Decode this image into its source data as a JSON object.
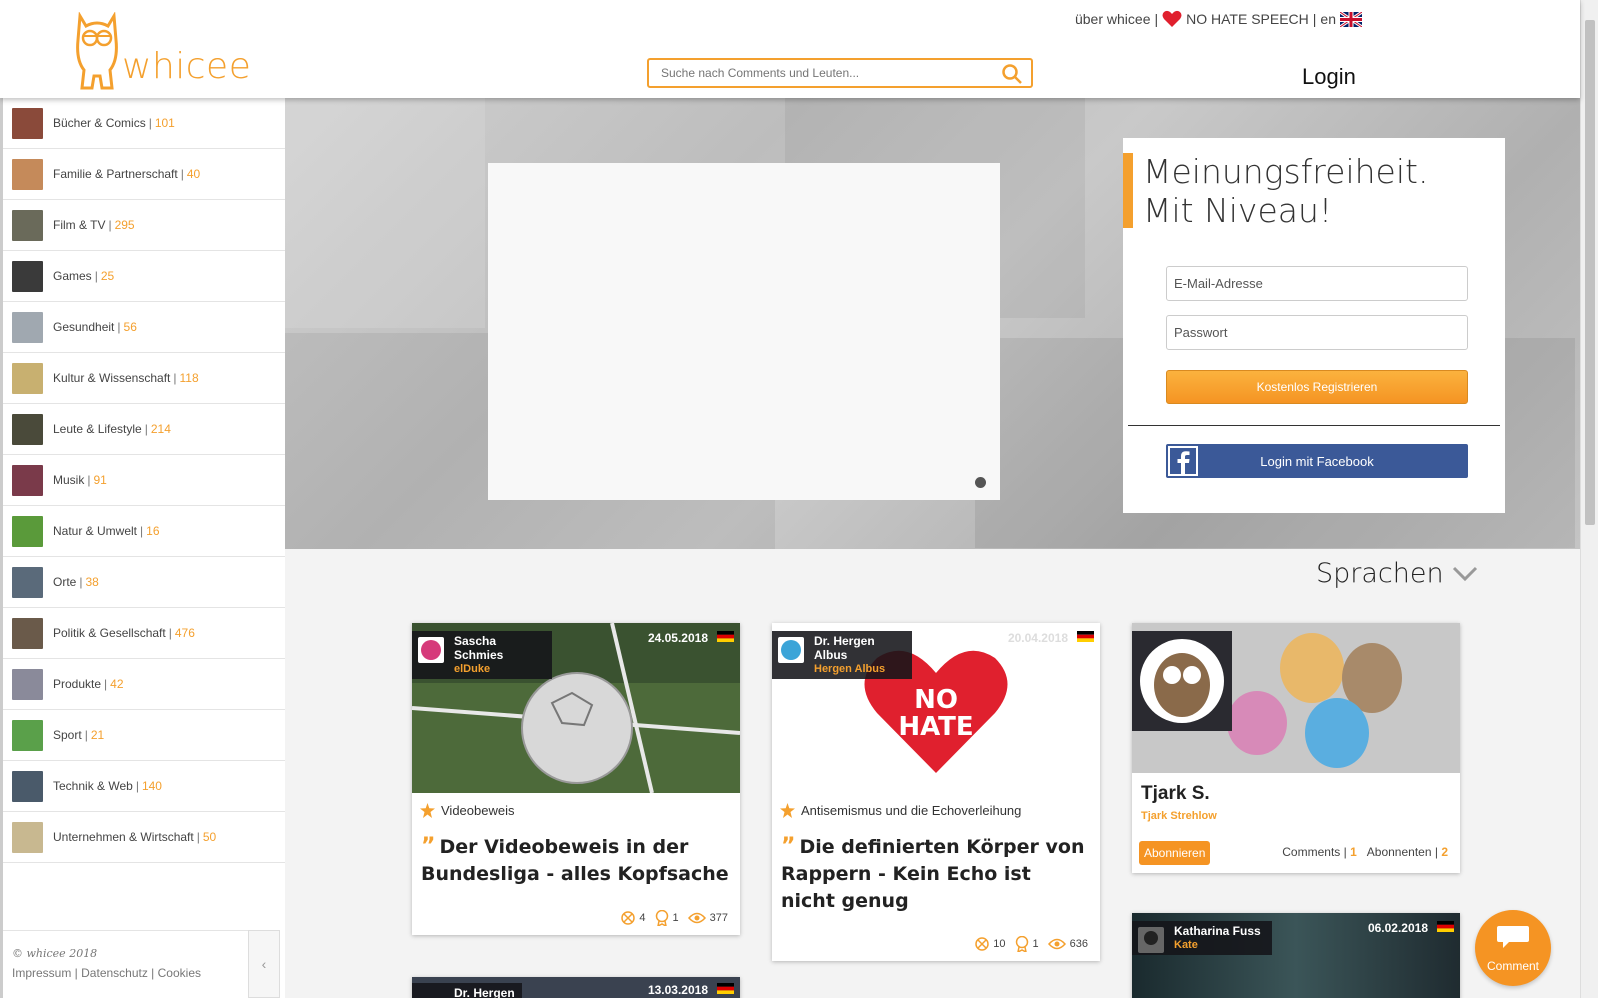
{
  "header": {
    "logo_text": "whicee",
    "top_links": {
      "about": "über whicee",
      "no_hate": "NO HATE SPEECH",
      "lang": "en"
    },
    "search_placeholder": "Suche nach Comments und Leuten...",
    "login": "Login"
  },
  "sidebar": {
    "categories": [
      {
        "name": "Bücher & Comics",
        "count": "101"
      },
      {
        "name": "Familie & Partnerschaft",
        "count": "40"
      },
      {
        "name": "Film & TV",
        "count": "295"
      },
      {
        "name": "Games",
        "count": "25"
      },
      {
        "name": "Gesundheit",
        "count": "56"
      },
      {
        "name": "Kultur & Wissenschaft",
        "count": "118"
      },
      {
        "name": "Leute & Lifestyle",
        "count": "214"
      },
      {
        "name": "Musik",
        "count": "91"
      },
      {
        "name": "Natur & Umwelt",
        "count": "16"
      },
      {
        "name": "Orte",
        "count": "38"
      },
      {
        "name": "Politik & Gesellschaft",
        "count": "476"
      },
      {
        "name": "Produkte",
        "count": "42"
      },
      {
        "name": "Sport",
        "count": "21"
      },
      {
        "name": "Technik & Web",
        "count": "140"
      },
      {
        "name": "Unternehmen & Wirtschaft",
        "count": "50"
      }
    ],
    "footer": {
      "copyright": "© whicee 2018",
      "impressum": "Impressum",
      "datenschutz": "Datenschutz",
      "cookies": "Cookies"
    }
  },
  "hero": {
    "claim_line1": "Meinungsfreiheit.",
    "claim_line2": "Mit Niveau!",
    "email_placeholder": "E-Mail-Adresse",
    "password_placeholder": "Passwort",
    "register_button": "Kostenlos Registrieren",
    "facebook_button": "Login mit Facebook"
  },
  "sprachen": "Sprachen",
  "cards": [
    {
      "author_name_1": "Sascha",
      "author_name_2": "Schmies",
      "author_handle": "elDuke",
      "date": "24.05.2018",
      "topic": "Videobeweis",
      "title": "Der Videobeweis in der Bundesliga - alles Kopfsache",
      "stats": {
        "opinions": "4",
        "awards": "1",
        "views": "377"
      }
    },
    {
      "author_name_1": "Dr. Hergen",
      "author_name_2": "Albus",
      "author_handle": "Hergen Albus",
      "date": "20.04.2018",
      "image_text_1": "NO",
      "image_text_2": "HATE",
      "topic": "Antisemismus und die Echoverleihung",
      "title": "Die definierten Körper von Rappern - Kein Echo ist nicht genug",
      "stats": {
        "opinions": "10",
        "awards": "1",
        "views": "636"
      }
    }
  ],
  "profile": {
    "name": "Tjark S.",
    "handle": "Tjark Strehlow",
    "subscribe": "Abonnieren",
    "comments_label": "Comments",
    "comments_count": "1",
    "subscribers_label": "Abonnenten",
    "subscribers_count": "2"
  },
  "card_bottom_left": {
    "author": "Dr. Hergen",
    "date": "13.03.2018"
  },
  "card_bottom_right": {
    "author": "Katharina Fuss",
    "handle": "Kate",
    "date": "06.02.2018"
  },
  "comment_button": "Comment",
  "colors": {
    "accent": "#f4a02e",
    "facebook": "#3b5998"
  }
}
